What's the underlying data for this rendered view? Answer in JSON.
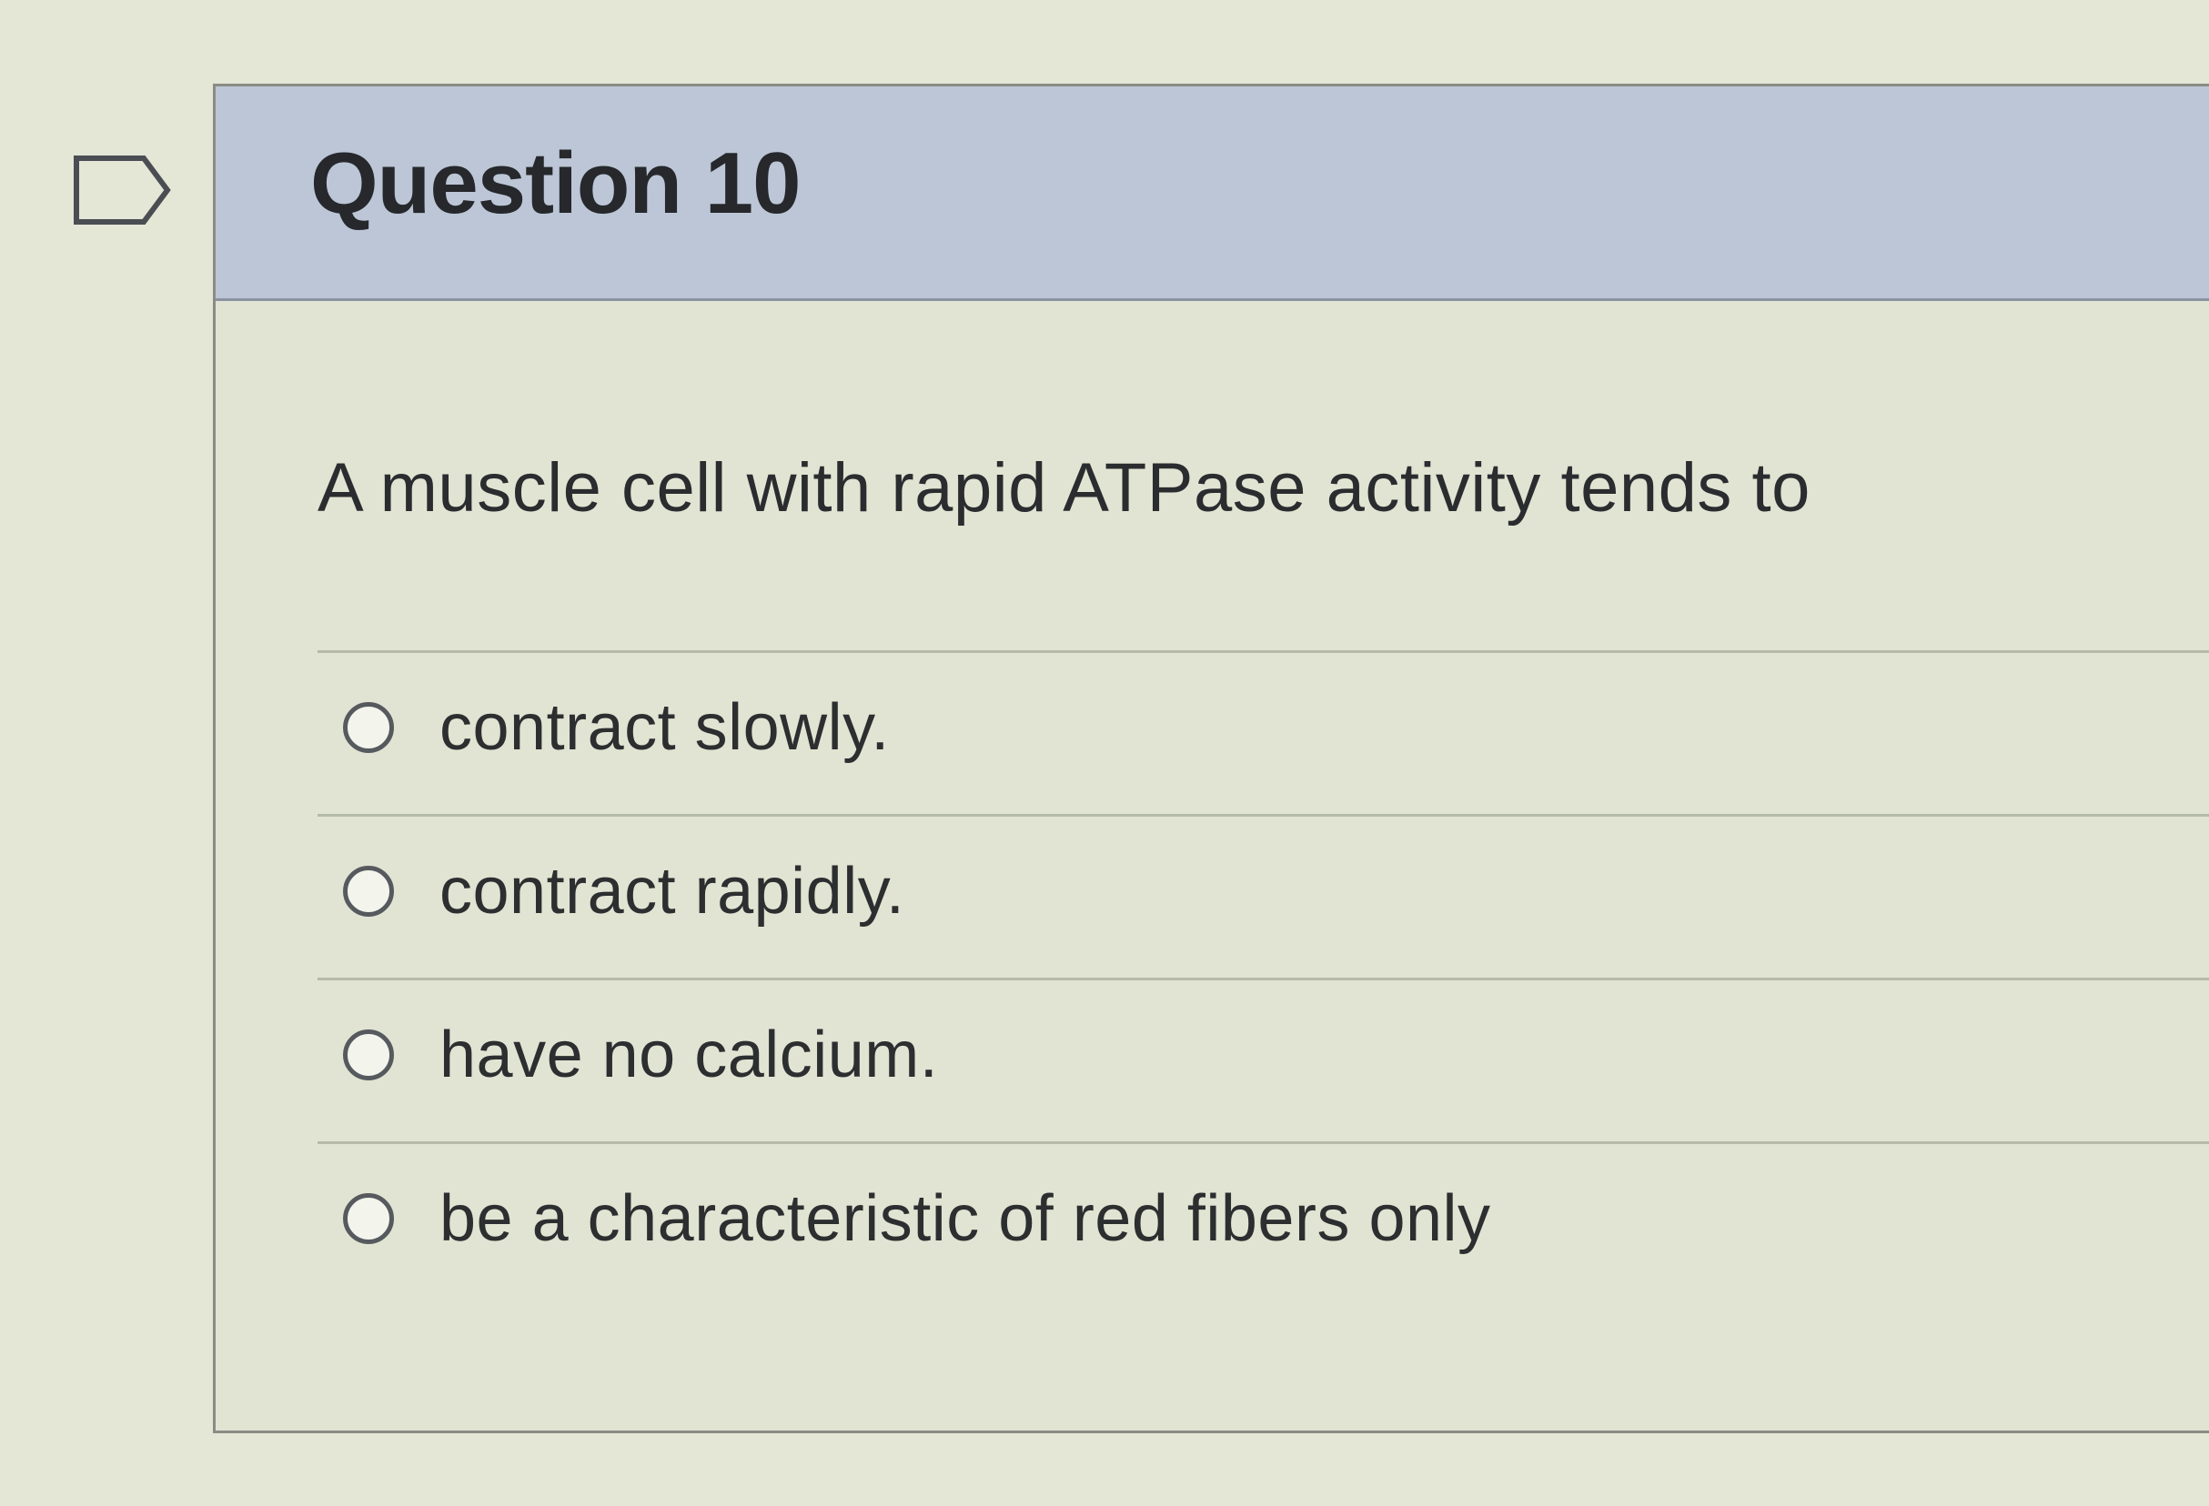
{
  "question": {
    "title": "Question 10",
    "text": "A muscle cell with rapid ATPase activity tends to"
  },
  "flag_icon": "flag-question-icon",
  "answers": [
    {
      "label": "contract slowly.",
      "selected": false
    },
    {
      "label": "contract rapidly.",
      "selected": false
    },
    {
      "label": "have no calcium.",
      "selected": false
    },
    {
      "label": "be a characteristic of red fibers only",
      "selected": false
    }
  ],
  "colors": {
    "header_background": "#bcc6d6",
    "card_background": "#e1e4d2",
    "text": "#2a2c2f"
  }
}
